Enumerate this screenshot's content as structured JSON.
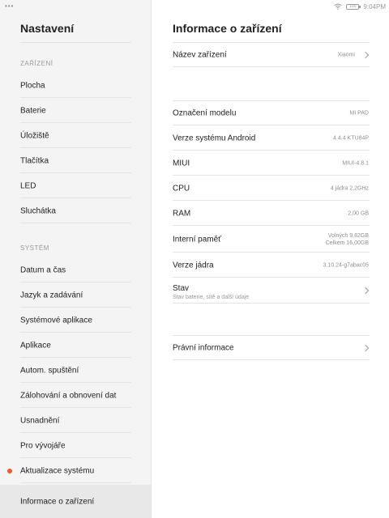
{
  "status_bar": {
    "time": "9:04PM",
    "battery": "100"
  },
  "left_pane": {
    "title": "Nastavení",
    "section1": "ZAŘÍZENÍ",
    "section1_items": [
      {
        "label": "Plocha"
      },
      {
        "label": "Baterie"
      },
      {
        "label": "Úložiště"
      },
      {
        "label": "Tlačítka"
      },
      {
        "label": "LED"
      },
      {
        "label": "Sluchátka"
      }
    ],
    "section2": "SYSTÉM",
    "section2_items": [
      {
        "label": "Datum a čas"
      },
      {
        "label": "Jazyk a zadávání"
      },
      {
        "label": "Systémové aplikace"
      },
      {
        "label": "Aplikace"
      },
      {
        "label": "Autom. spuštění"
      },
      {
        "label": "Zálohování a obnovení dat"
      },
      {
        "label": "Usnadnění"
      },
      {
        "label": "Pro vývojáře"
      },
      {
        "label": "Aktualizace systému",
        "badge_color": "#f15a29"
      },
      {
        "label": "Informace o zařízení",
        "selected": true
      }
    ]
  },
  "right_pane": {
    "title": "Informace o zařízení",
    "device_name": {
      "label": "Název zařízení",
      "value": "Xiaomi"
    },
    "rows": [
      {
        "label": "Označení modelu",
        "value": "MI PAD"
      },
      {
        "label": "Verze systému Android",
        "value": "4.4.4 KTU84P"
      },
      {
        "label": "MIUI",
        "value": "MIUI-4.8.1"
      },
      {
        "label": "CPU",
        "value": "4 jádra 2,2GHz"
      },
      {
        "label": "RAM",
        "value": "2,00 GB"
      },
      {
        "label": "Interní paměť",
        "value_line1": "Volných 9,82GB",
        "value_line2": "Celkem 16,00GB"
      },
      {
        "label": "Verze jádra",
        "value": "3.10.24-g7abac05"
      }
    ],
    "status": {
      "label": "Stav",
      "sublabel": "Stav baterie, sítě a další údaje"
    },
    "legal": {
      "label": "Právní informace"
    }
  }
}
